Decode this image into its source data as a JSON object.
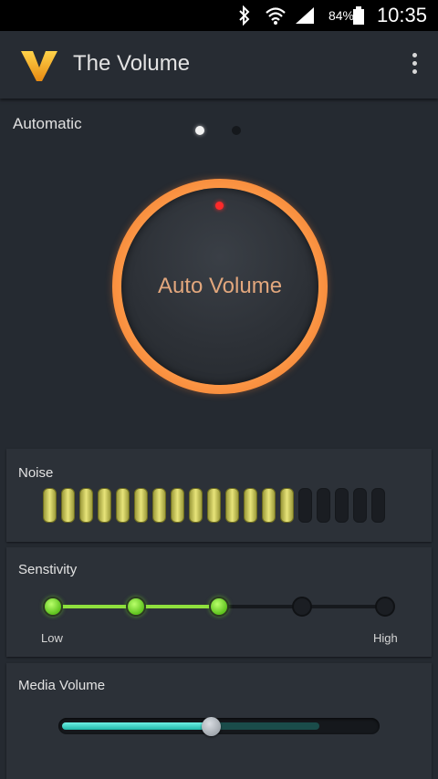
{
  "status_bar": {
    "bluetooth_icon": "bluetooth-icon",
    "wifi_icon": "wifi-icon",
    "signal_icon": "signal-icon",
    "battery_percent": "84%",
    "battery_icon": "battery-icon",
    "time": "10:35"
  },
  "app_bar": {
    "logo_icon": "v-logo-icon",
    "title": "The Volume",
    "menu_icon": "overflow-menu-icon"
  },
  "mode": {
    "label": "Automatic",
    "page_count": 2,
    "active_page": 0
  },
  "knob": {
    "label": "Auto Volume",
    "accent": "#ff9b4a",
    "indicator_color": "#ff2a2a"
  },
  "noise": {
    "title": "Noise",
    "segments_total": 19,
    "segments_lit": 14,
    "lit_color": "#e8e47a"
  },
  "sensitivity": {
    "title": "Senstivity",
    "levels": 5,
    "selected_level": 3,
    "low_label": "Low",
    "high_label": "High",
    "active_color": "#8fe03e"
  },
  "media_volume": {
    "title": "Media Volume",
    "level_fraction": 0.47,
    "secondary_fraction": 0.81,
    "track_color": "#4fd9cc"
  }
}
